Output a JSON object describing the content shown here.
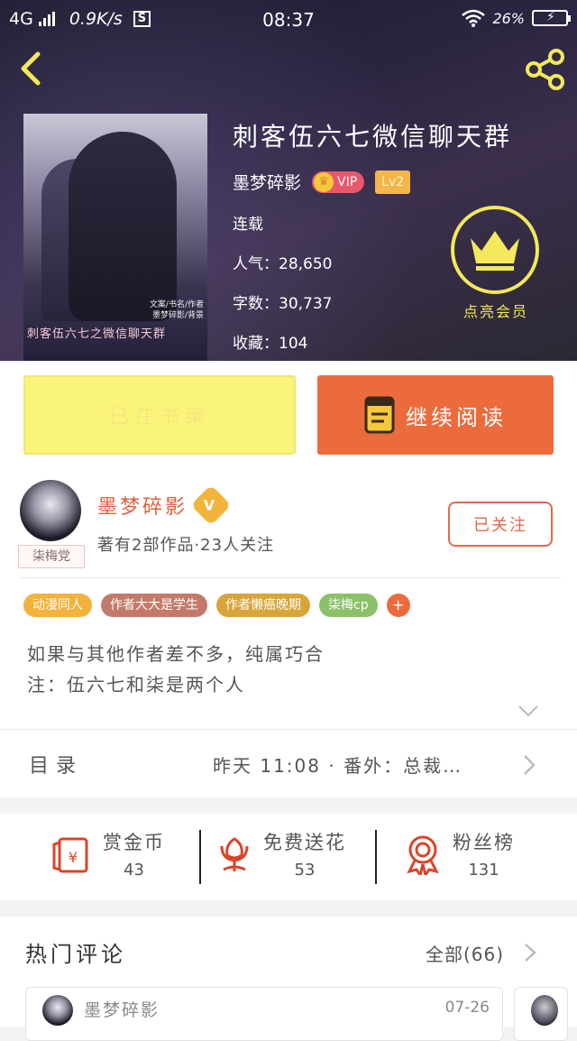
{
  "status_bar": {
    "network": "4G",
    "speed": "0.9K/s",
    "sim": "S",
    "time": "08:37",
    "battery": "26%"
  },
  "book": {
    "title": "刺客伍六七微信聊天群",
    "author": "墨梦碎影",
    "vip_label": "VIP",
    "level_label": "Lv2",
    "status": "连载",
    "popularity": "人气：28,650",
    "word_count": "字数：30,737",
    "favorites": "收藏：104",
    "cover_title": "刺客伍六七之微信聊天群",
    "cover_credit_1": "文案/书名/作者",
    "cover_credit_2": "墨梦碎影/背景"
  },
  "member": {
    "label": "点亮会员"
  },
  "actions": {
    "shelf_label": "已在书架",
    "read_label": "继续阅读"
  },
  "author_card": {
    "name": "墨梦碎影",
    "verified_label": "V",
    "avatar_tag": "柒梅党",
    "stats": "著有2部作品·23人关注",
    "follow_label": "已关注",
    "tags": [
      {
        "label": "动漫同人",
        "color": "#f2b23c"
      },
      {
        "label": "作者大大是学生",
        "color": "#c47a6a"
      },
      {
        "label": "作者懒癌晚期",
        "color": "#d8a53a"
      },
      {
        "label": "柒梅cp",
        "color": "#8cc06a"
      }
    ],
    "tag_more": "+",
    "intro_line_1": "如果与其他作者差不多，纯属巧合",
    "intro_line_2": "注：伍六七和柒是两个人"
  },
  "toc": {
    "label": "目录",
    "latest": "昨天 11:08 · 番外：总裁…"
  },
  "stats": {
    "coins_label": "赏金币",
    "coins_value": "43",
    "flowers_label": "免费送花",
    "flowers_value": "53",
    "fans_label": "粉丝榜",
    "fans_value": "131"
  },
  "comments": {
    "title": "热门评论",
    "all_label": "全部(66)",
    "first": {
      "name": "墨梦碎影",
      "date": "07-26"
    }
  },
  "colors": {
    "accent_orange": "#ec6b3d",
    "shelf_yellow": "#fbf47a",
    "member_yellow": "#f3e95a",
    "author_red": "#e06040"
  }
}
